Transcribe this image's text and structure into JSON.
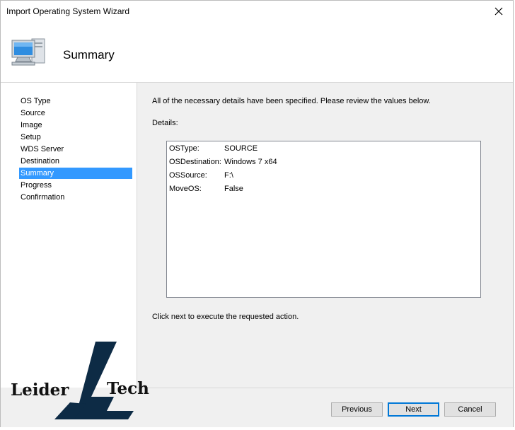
{
  "window": {
    "title": "Import Operating System Wizard"
  },
  "header": {
    "title": "Summary"
  },
  "nav": {
    "items": [
      {
        "label": "OS Type",
        "selected": false
      },
      {
        "label": "Source",
        "selected": false
      },
      {
        "label": "Image",
        "selected": false
      },
      {
        "label": "Setup",
        "selected": false
      },
      {
        "label": "WDS Server",
        "selected": false
      },
      {
        "label": "Destination",
        "selected": false
      },
      {
        "label": "Summary",
        "selected": true
      },
      {
        "label": "Progress",
        "selected": false
      },
      {
        "label": "Confirmation",
        "selected": false
      }
    ]
  },
  "content": {
    "intro": "All of the necessary details have been specified.  Please review the values below.",
    "details_label": "Details:",
    "details": [
      {
        "key": "OSType:",
        "value": "SOURCE"
      },
      {
        "key": "OSDestination:",
        "value": "Windows 7 x64"
      },
      {
        "key": "OSSource:",
        "value": "F:\\"
      },
      {
        "key": "MoveOS:",
        "value": "False"
      }
    ],
    "hint": "Click next to execute the requested action."
  },
  "buttons": {
    "previous": "Previous",
    "next": "Next",
    "cancel": "Cancel"
  },
  "watermark": {
    "left_word": "Leider",
    "right_word": "Tech"
  },
  "colors": {
    "selection": "#3399ff",
    "default_button_border": "#0078d7"
  }
}
